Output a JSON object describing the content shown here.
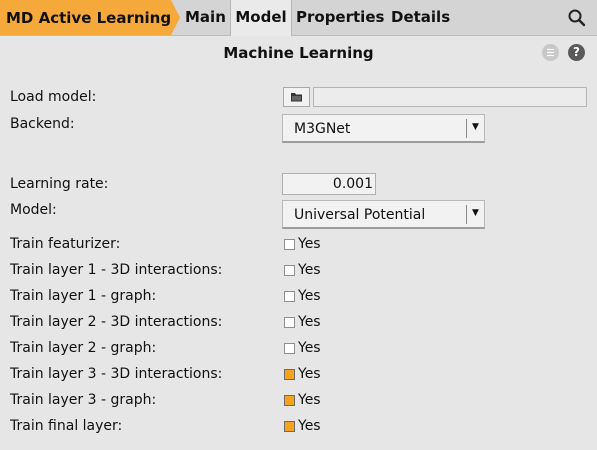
{
  "header": {
    "breadcrumb": "MD Active Learning",
    "tabs": [
      {
        "label": "Main"
      },
      {
        "label": "Model"
      },
      {
        "label": "Properties"
      },
      {
        "label": "Details"
      }
    ],
    "active_tab": "Model",
    "search_icon": "search-icon"
  },
  "panel": {
    "title": "Machine Learning",
    "menu_icon": "list-icon",
    "help_icon": "help-icon",
    "help_glyph": "?"
  },
  "form": {
    "load_model": {
      "label": "Load model:",
      "value": "",
      "button_icon": "folder-icon"
    },
    "backend": {
      "label": "Backend:",
      "value": "M3GNet"
    },
    "learning_rate": {
      "label": "Learning rate:",
      "value": "0.001"
    },
    "model": {
      "label": "Model:",
      "value": "Universal Potential"
    },
    "toggles": [
      {
        "label": "Train featurizer:",
        "text": "Yes",
        "checked": false
      },
      {
        "label": "Train layer 1 - 3D interactions:",
        "text": "Yes",
        "checked": false
      },
      {
        "label": "Train layer 1 - graph:",
        "text": "Yes",
        "checked": false
      },
      {
        "label": "Train layer 2 - 3D interactions:",
        "text": "Yes",
        "checked": false
      },
      {
        "label": "Train layer 2 - graph:",
        "text": "Yes",
        "checked": false
      },
      {
        "label": "Train layer 3 - 3D interactions:",
        "text": "Yes",
        "checked": true
      },
      {
        "label": "Train layer 3 - graph:",
        "text": "Yes",
        "checked": true
      },
      {
        "label": "Train final layer:",
        "text": "Yes",
        "checked": true
      }
    ]
  },
  "colors": {
    "accent": "#f5a31a",
    "breadcrumb_bg": "#f4a93a",
    "background": "#e6e6e6"
  }
}
